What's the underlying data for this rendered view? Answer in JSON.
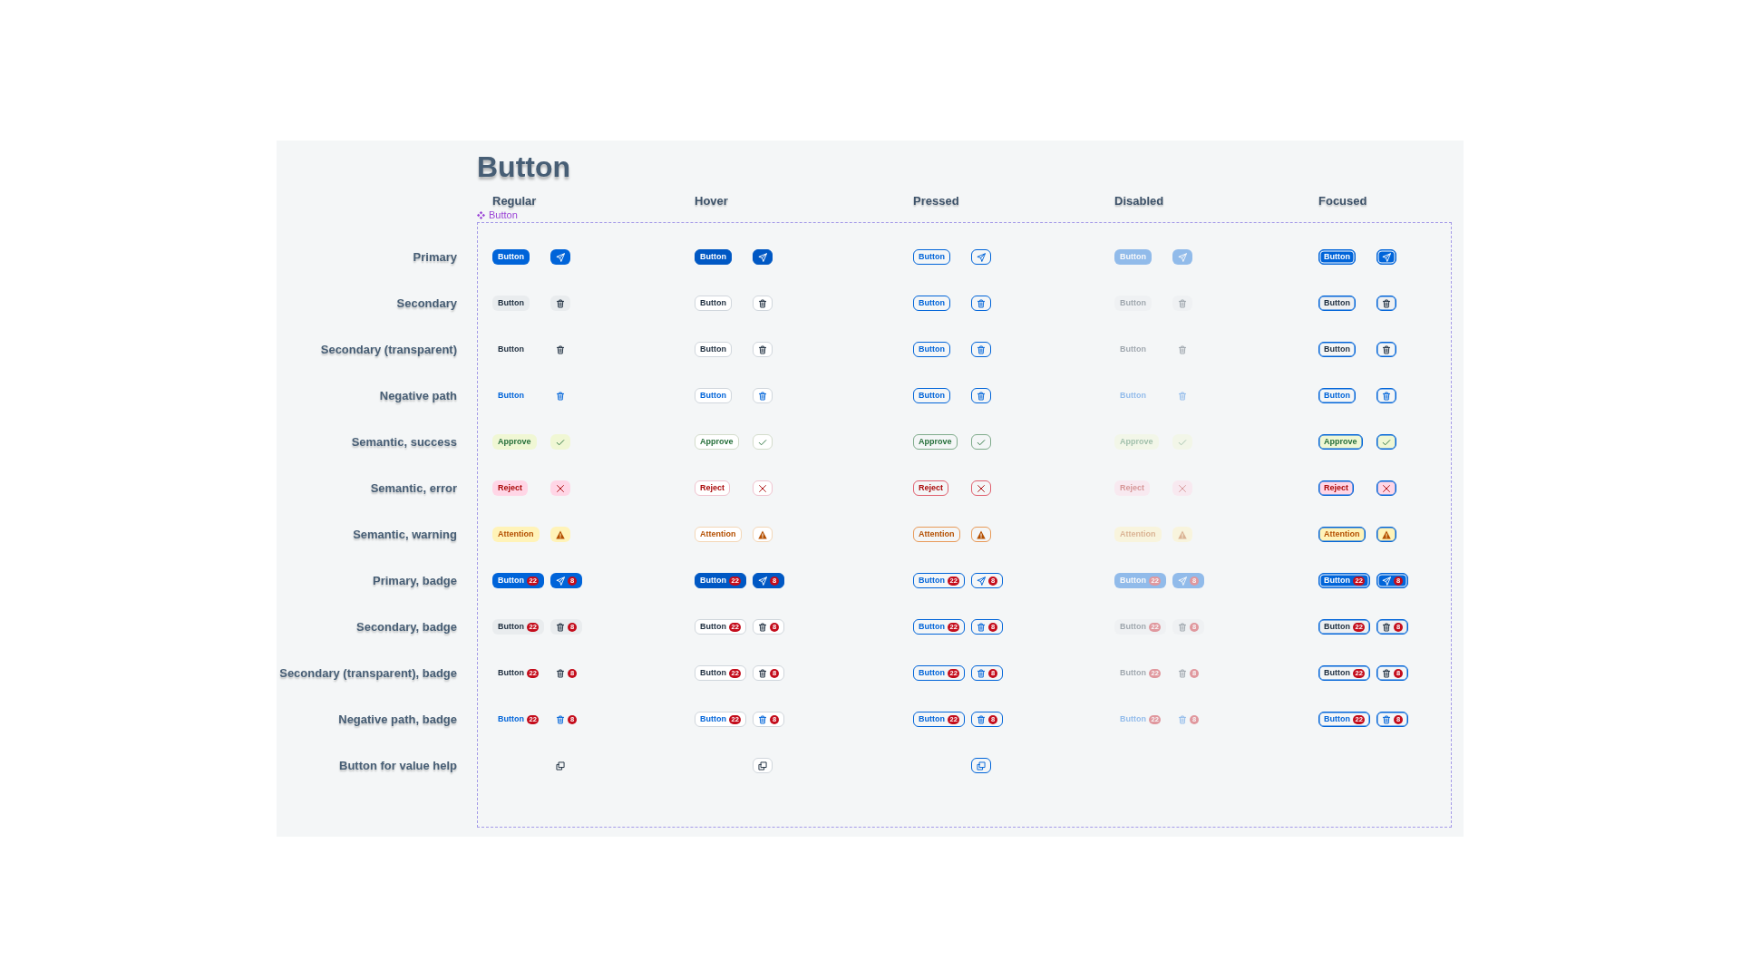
{
  "title": "Button",
  "columns": [
    {
      "label": "Regular"
    },
    {
      "label": "Hover"
    },
    {
      "label": "Pressed"
    },
    {
      "label": "Disabled"
    },
    {
      "label": "Focused"
    }
  ],
  "component_tag": {
    "label": "Button"
  },
  "rows": [
    {
      "label": "Primary",
      "kind": "primary",
      "cells": [
        {
          "text": "Button",
          "hover": false,
          "pressed": false,
          "disabled": false,
          "focused": false
        },
        {
          "text": "Button",
          "hover": true,
          "pressed": false,
          "disabled": false,
          "focused": false
        },
        {
          "text": "Button",
          "hover": false,
          "pressed": true,
          "disabled": false,
          "focused": false
        },
        {
          "text": "Button",
          "hover": false,
          "pressed": false,
          "disabled": true,
          "focused": false
        },
        {
          "text": "Button",
          "hover": false,
          "pressed": false,
          "disabled": false,
          "focused": true
        }
      ]
    },
    {
      "label": "Secondary",
      "kind": "secondary",
      "cells": [
        {
          "text": "Button",
          "hover": false,
          "pressed": false,
          "disabled": false,
          "focused": false
        },
        {
          "text": "Button",
          "hover": true,
          "pressed": false,
          "disabled": false,
          "focused": false
        },
        {
          "text": "Button",
          "hover": false,
          "pressed": true,
          "disabled": false,
          "focused": false
        },
        {
          "text": "Button",
          "hover": false,
          "pressed": false,
          "disabled": true,
          "focused": false
        },
        {
          "text": "Button",
          "hover": false,
          "pressed": false,
          "disabled": false,
          "focused": true
        }
      ]
    },
    {
      "label": "Secondary (transparent)",
      "kind": "transparent",
      "cells": [
        {
          "text": "Button",
          "hover": false,
          "pressed": false,
          "disabled": false,
          "focused": false
        },
        {
          "text": "Button",
          "hover": true,
          "pressed": false,
          "disabled": false,
          "focused": false
        },
        {
          "text": "Button",
          "hover": false,
          "pressed": true,
          "disabled": false,
          "focused": false
        },
        {
          "text": "Button",
          "hover": false,
          "pressed": false,
          "disabled": true,
          "focused": false
        },
        {
          "text": "Button",
          "hover": false,
          "pressed": false,
          "disabled": false,
          "focused": true
        }
      ]
    },
    {
      "label": "Negative path",
      "kind": "negative",
      "cells": [
        {
          "text": "Button",
          "hover": false,
          "pressed": false,
          "disabled": false,
          "focused": false
        },
        {
          "text": "Button",
          "hover": true,
          "pressed": false,
          "disabled": false,
          "focused": false
        },
        {
          "text": "Button",
          "hover": false,
          "pressed": true,
          "disabled": false,
          "focused": false
        },
        {
          "text": "Button",
          "hover": false,
          "pressed": false,
          "disabled": true,
          "focused": false
        },
        {
          "text": "Button",
          "hover": false,
          "pressed": false,
          "disabled": false,
          "focused": true
        }
      ]
    },
    {
      "label": "Semantic, success",
      "kind": "success",
      "cells": [
        {
          "text": "Approve",
          "hover": false,
          "pressed": false,
          "disabled": false,
          "focused": false
        },
        {
          "text": "Approve",
          "hover": true,
          "pressed": false,
          "disabled": false,
          "focused": false
        },
        {
          "text": "Approve",
          "hover": false,
          "pressed": true,
          "disabled": false,
          "focused": false
        },
        {
          "text": "Approve",
          "hover": false,
          "pressed": false,
          "disabled": true,
          "focused": false
        },
        {
          "text": "Approve",
          "hover": false,
          "pressed": false,
          "disabled": false,
          "focused": true
        }
      ]
    },
    {
      "label": "Semantic, error",
      "kind": "error",
      "cells": [
        {
          "text": "Reject",
          "hover": false,
          "pressed": false,
          "disabled": false,
          "focused": false
        },
        {
          "text": "Reject",
          "hover": true,
          "pressed": false,
          "disabled": false,
          "focused": false
        },
        {
          "text": "Reject",
          "hover": false,
          "pressed": true,
          "disabled": false,
          "focused": false
        },
        {
          "text": "Reject",
          "hover": false,
          "pressed": false,
          "disabled": true,
          "focused": false
        },
        {
          "text": "Reject",
          "hover": false,
          "pressed": false,
          "disabled": false,
          "focused": true
        }
      ]
    },
    {
      "label": "Semantic, warning",
      "kind": "warning",
      "cells": [
        {
          "text": "Attention",
          "hover": false,
          "pressed": false,
          "disabled": false,
          "focused": false
        },
        {
          "text": "Attention",
          "hover": true,
          "pressed": false,
          "disabled": false,
          "focused": false
        },
        {
          "text": "Attention",
          "hover": false,
          "pressed": true,
          "disabled": false,
          "focused": false
        },
        {
          "text": "Attention",
          "hover": false,
          "pressed": false,
          "disabled": true,
          "focused": false
        },
        {
          "text": "Attention",
          "hover": false,
          "pressed": false,
          "disabled": false,
          "focused": true
        }
      ]
    },
    {
      "label": "Primary, badge",
      "kind": "primary",
      "cells": [
        {
          "text": "Button",
          "badge": "22",
          "icon_badge": "8",
          "hover": false,
          "pressed": false,
          "disabled": false,
          "focused": false
        },
        {
          "text": "Button",
          "badge": "22",
          "icon_badge": "8",
          "hover": true,
          "pressed": false,
          "disabled": false,
          "focused": false
        },
        {
          "text": "Button",
          "badge": "22",
          "icon_badge": "8",
          "hover": false,
          "pressed": true,
          "disabled": false,
          "focused": false
        },
        {
          "text": "Button",
          "badge": "22",
          "icon_badge": "8",
          "hover": false,
          "pressed": false,
          "disabled": true,
          "focused": false
        },
        {
          "text": "Button",
          "badge": "22",
          "icon_badge": "8",
          "hover": false,
          "pressed": false,
          "disabled": false,
          "focused": true
        }
      ]
    },
    {
      "label": "Secondary, badge",
      "kind": "secondary",
      "cells": [
        {
          "text": "Button",
          "badge": "22",
          "icon_badge": "8",
          "hover": false,
          "pressed": false,
          "disabled": false,
          "focused": false
        },
        {
          "text": "Button",
          "badge": "22",
          "icon_badge": "8",
          "hover": true,
          "pressed": false,
          "disabled": false,
          "focused": false
        },
        {
          "text": "Button",
          "badge": "22",
          "icon_badge": "8",
          "hover": false,
          "pressed": true,
          "disabled": false,
          "focused": false
        },
        {
          "text": "Button",
          "badge": "22",
          "icon_badge": "8",
          "hover": false,
          "pressed": false,
          "disabled": true,
          "focused": false
        },
        {
          "text": "Button",
          "badge": "22",
          "icon_badge": "8",
          "hover": false,
          "pressed": false,
          "disabled": false,
          "focused": true
        }
      ]
    },
    {
      "label": "Secondary (transparent), badge",
      "kind": "transparent",
      "cells": [
        {
          "text": "Button",
          "badge": "22",
          "icon_badge": "8",
          "hover": false,
          "pressed": false,
          "disabled": false,
          "focused": false
        },
        {
          "text": "Button",
          "badge": "22",
          "icon_badge": "8",
          "hover": true,
          "pressed": false,
          "disabled": false,
          "focused": false
        },
        {
          "text": "Button",
          "badge": "22",
          "icon_badge": "8",
          "hover": false,
          "pressed": true,
          "disabled": false,
          "focused": false
        },
        {
          "text": "Button",
          "badge": "22",
          "icon_badge": "8",
          "hover": false,
          "pressed": false,
          "disabled": true,
          "focused": false
        },
        {
          "text": "Button",
          "badge": "22",
          "icon_badge": "8",
          "hover": false,
          "pressed": false,
          "disabled": false,
          "focused": true
        }
      ]
    },
    {
      "label": "Negative path, badge",
      "kind": "negative",
      "cells": [
        {
          "text": "Button",
          "badge": "22",
          "icon_badge": "8",
          "hover": false,
          "pressed": false,
          "disabled": false,
          "focused": false
        },
        {
          "text": "Button",
          "badge": "22",
          "icon_badge": "8",
          "hover": true,
          "pressed": false,
          "disabled": false,
          "focused": false
        },
        {
          "text": "Button",
          "badge": "22",
          "icon_badge": "8",
          "hover": false,
          "pressed": true,
          "disabled": false,
          "focused": false
        },
        {
          "text": "Button",
          "badge": "22",
          "icon_badge": "8",
          "hover": false,
          "pressed": false,
          "disabled": true,
          "focused": false
        },
        {
          "text": "Button",
          "badge": "22",
          "icon_badge": "8",
          "hover": false,
          "pressed": false,
          "disabled": false,
          "focused": true
        }
      ]
    },
    {
      "label": "Button for value help",
      "kind": "value_help",
      "cells": [
        {
          "hover": false,
          "pressed": false,
          "disabled": false,
          "focused": false
        },
        {
          "hover": true,
          "pressed": false,
          "disabled": false,
          "focused": false
        },
        {
          "hover": false,
          "pressed": true,
          "disabled": false,
          "focused": false
        }
      ]
    }
  ]
}
